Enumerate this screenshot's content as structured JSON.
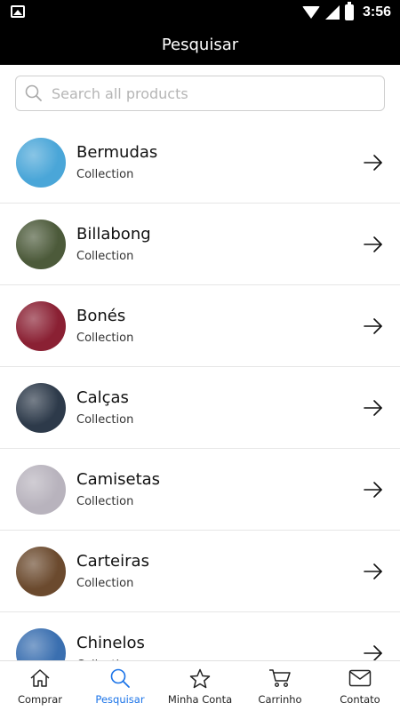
{
  "status_bar": {
    "time": "3:56"
  },
  "header": {
    "title": "Pesquisar"
  },
  "search": {
    "placeholder": "Search all products",
    "value": ""
  },
  "collections": [
    {
      "name": "Bermudas",
      "subtitle": "Collection",
      "thumb_color": "#4aa6d8"
    },
    {
      "name": "Billabong",
      "subtitle": "Collection",
      "thumb_color": "#4c5a3a"
    },
    {
      "name": "Bonés",
      "subtitle": "Collection",
      "thumb_color": "#8a2033"
    },
    {
      "name": "Calças",
      "subtitle": "Collection",
      "thumb_color": "#2d3a4a"
    },
    {
      "name": "Camisetas",
      "subtitle": "Collection",
      "thumb_color": "#b8b3bd"
    },
    {
      "name": "Carteiras",
      "subtitle": "Collection",
      "thumb_color": "#6b4a2e"
    },
    {
      "name": "Chinelos",
      "subtitle": "Collection",
      "thumb_color": "#3a6fb0"
    }
  ],
  "tabs": [
    {
      "label": "Comprar",
      "icon": "home-icon",
      "active": false
    },
    {
      "label": "Pesquisar",
      "icon": "search-icon",
      "active": true
    },
    {
      "label": "Minha Conta",
      "icon": "star-icon",
      "active": false
    },
    {
      "label": "Carrinho",
      "icon": "cart-icon",
      "active": false
    },
    {
      "label": "Contato",
      "icon": "mail-icon",
      "active": false
    }
  ],
  "colors": {
    "active_tab": "#1a73e8",
    "header_bg": "#000000"
  }
}
